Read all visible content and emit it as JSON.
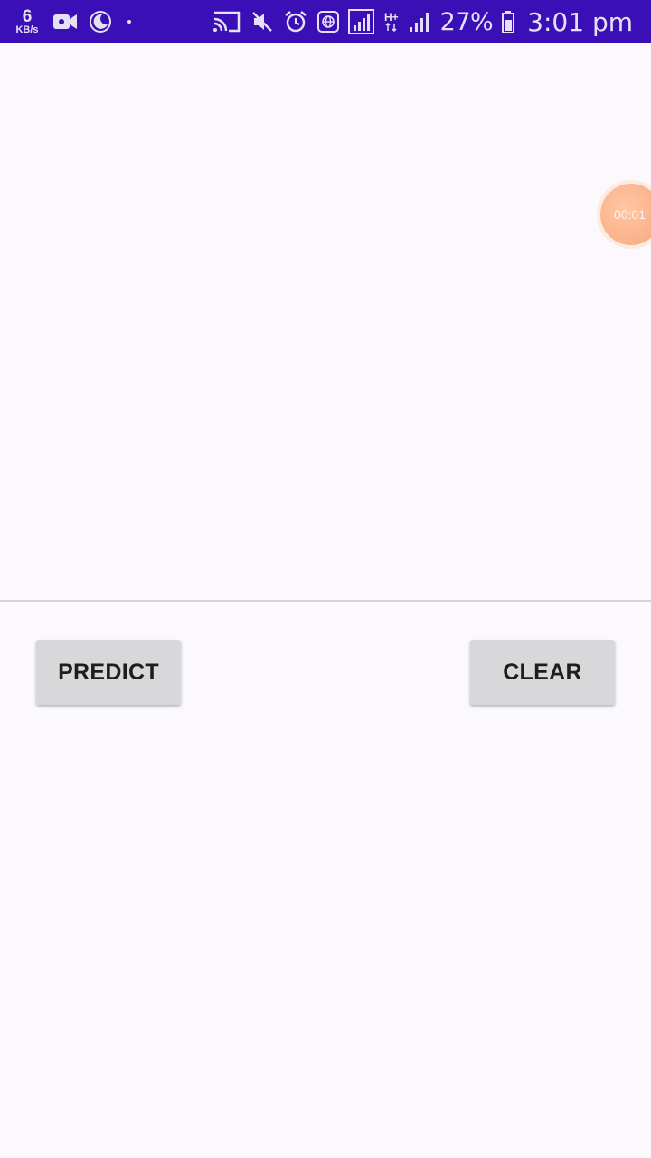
{
  "status_bar": {
    "net_speed_value": "6",
    "net_speed_unit": "KB/s",
    "network_type": "H+",
    "battery": "27%",
    "time": "3:01 pm",
    "icons": [
      "video-camera-icon",
      "moon-icon",
      "dot-icon",
      "cast-icon",
      "mute-icon",
      "alarm-icon",
      "globe-icon",
      "signal-icon",
      "signal-icon-2",
      "battery-icon"
    ]
  },
  "main": {
    "predict_label": "PREDICT",
    "clear_label": "CLEAR"
  },
  "recorder": {
    "timer": "00:01"
  },
  "colors": {
    "status_bar": "#3a0fb5",
    "background": "#fbf9fc",
    "button": "#d8d7d9",
    "recorder_bubble": "#f9b188"
  }
}
